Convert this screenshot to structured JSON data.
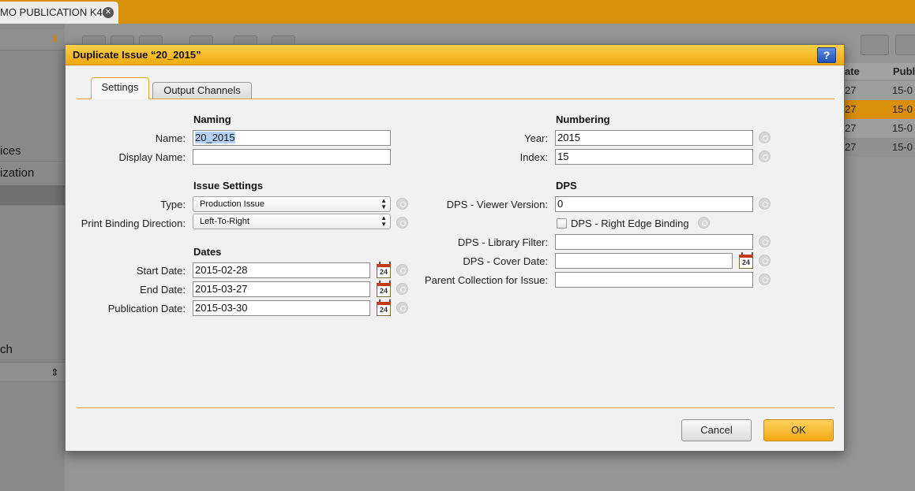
{
  "app": {
    "doc_tab": "MO PUBLICATION K4",
    "sidebar_rows": [
      "ices",
      "ization",
      "ch"
    ],
    "grid_headers": [
      "ate",
      "Publ"
    ],
    "grid_rows": [
      {
        "date": "27",
        "pub": "15-0"
      },
      {
        "date": "27",
        "pub": "15-0"
      },
      {
        "date": "27",
        "pub": "15-0"
      },
      {
        "date": "27",
        "pub": "15-0"
      }
    ],
    "colors": {
      "accent": "#d88f0a",
      "selected_row": "#e3a224"
    }
  },
  "dialog": {
    "title": "Duplicate Issue “20_2015”",
    "help": "?",
    "tabs": {
      "settings": "Settings",
      "output": "Output Channels"
    },
    "naming": {
      "heading": "Naming",
      "name_label": "Name:",
      "name_value": "20_2015",
      "display_label": "Display Name:",
      "display_value": ""
    },
    "issue_settings": {
      "heading": "Issue Settings",
      "type_label": "Type:",
      "type_value": "Production Issue",
      "binding_label": "Print Binding Direction:",
      "binding_value": "Left-To-Right"
    },
    "dates": {
      "heading": "Dates",
      "start_label": "Start Date:",
      "start_value": "2015-02-28",
      "end_label": "End Date:",
      "end_value": "2015-03-27",
      "pub_label": "Publication Date:",
      "pub_value": "2015-03-30",
      "calendar_day": "24"
    },
    "numbering": {
      "heading": "Numbering",
      "year_label": "Year:",
      "year_value": "2015",
      "index_label": "Index:",
      "index_value": "15"
    },
    "dps": {
      "heading": "DPS",
      "viewer_label": "DPS - Viewer Version:",
      "viewer_value": "0",
      "edge_label": "DPS - Right Edge Binding",
      "edge_checked": false,
      "library_label": "DPS - Library Filter:",
      "library_value": "",
      "cover_label": "DPS - Cover Date:",
      "cover_value": "",
      "parent_label": "Parent Collection for Issue:",
      "parent_value": ""
    },
    "buttons": {
      "cancel": "Cancel",
      "ok": "OK"
    }
  }
}
